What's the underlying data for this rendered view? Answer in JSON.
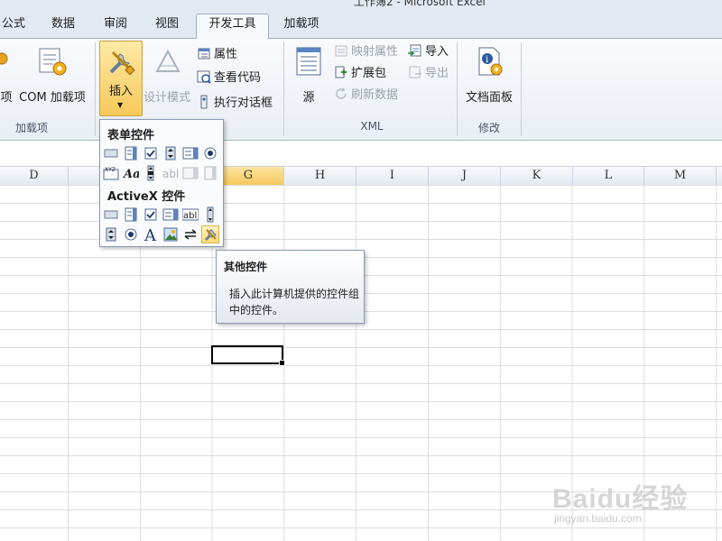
{
  "window": {
    "title": "工作簿2 - Microsoft Excel"
  },
  "tabs": [
    {
      "label": "公式"
    },
    {
      "label": "数据"
    },
    {
      "label": "审阅"
    },
    {
      "label": "视图"
    },
    {
      "label": "开发工具",
      "active": true
    },
    {
      "label": "加载项"
    }
  ],
  "ribbon": {
    "addins": {
      "partial_label": "项",
      "com_label": "COM 加载项",
      "group_label": "加载项"
    },
    "controls": {
      "insert_label": "插入",
      "design_mode_label": "设计模式",
      "properties_label": "属性",
      "view_code_label": "查看代码",
      "run_dialog_label": "执行对话框"
    },
    "xml": {
      "source_label": "源",
      "map_properties_label": "映射属性",
      "expansion_packs_label": "扩展包",
      "refresh_data_label": "刷新数据",
      "import_label": "导入",
      "export_label": "导出",
      "group_label": "XML"
    },
    "modify": {
      "document_panel_label": "文档面板",
      "group_label": "修改"
    }
  },
  "grid": {
    "columns": [
      "D",
      "E",
      "F",
      "G",
      "H",
      "I",
      "J",
      "K",
      "L",
      "M"
    ],
    "selected_column": "G"
  },
  "dropdown": {
    "form_controls_header": "表单控件",
    "activex_header": "ActiveX 控件"
  },
  "tooltip": {
    "title": "其他控件",
    "body": "插入此计算机提供的控件组中的控件。"
  },
  "watermark": {
    "brand": "Baidu经验",
    "url": "jingyan.baidu.com"
  },
  "colors": {
    "accent_selected": "#f7c95a",
    "ribbon_bg": "#e9eef5"
  }
}
